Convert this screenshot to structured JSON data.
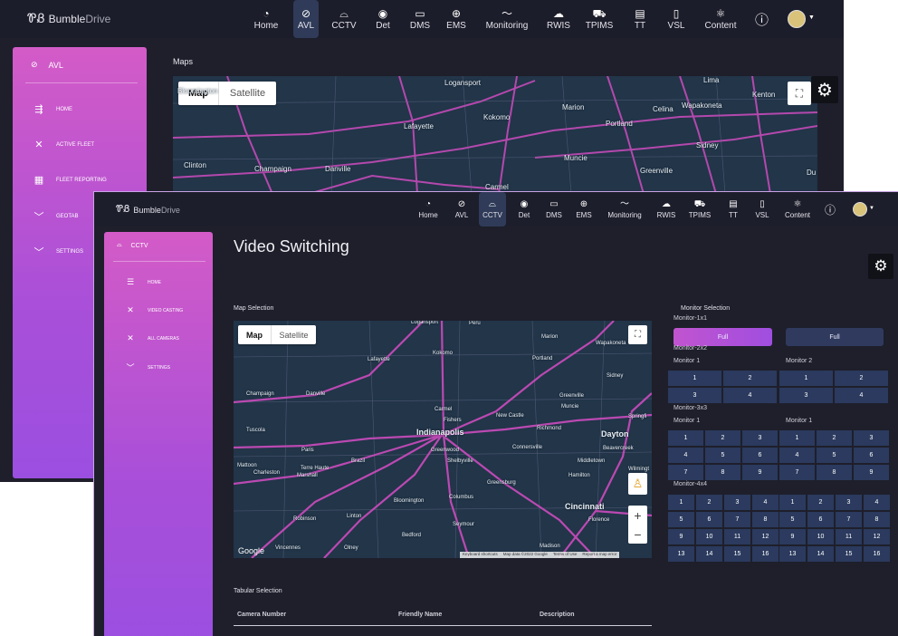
{
  "nav": {
    "items": [
      {
        "label": "Home",
        "icon": "pie-chart-icon"
      },
      {
        "label": "AVL",
        "icon": "compass-icon"
      },
      {
        "label": "CCTV",
        "icon": "camera-icon"
      },
      {
        "label": "Det",
        "icon": "radar-icon"
      },
      {
        "label": "DMS",
        "icon": "sign-icon"
      },
      {
        "label": "EMS",
        "icon": "globe-icon"
      },
      {
        "label": "Monitoring",
        "icon": "pulse-icon"
      },
      {
        "label": "RWIS",
        "icon": "cloud-icon"
      },
      {
        "label": "TPIMS",
        "icon": "truck-icon"
      },
      {
        "label": "TT",
        "icon": "board-icon"
      },
      {
        "label": "VSL",
        "icon": "phone-icon"
      },
      {
        "label": "Content",
        "icon": "atom-icon"
      }
    ],
    "info_glyph": "ⓘ"
  },
  "logo": {
    "part1": "Bumble",
    "part2": "Drive"
  },
  "back_window": {
    "active_tab": "AVL",
    "sidebar": {
      "title": "AVL",
      "items": [
        {
          "label": "HOME",
          "icon": "route-icon"
        },
        {
          "label": "ACTIVE FLEET",
          "icon": "tools-icon"
        },
        {
          "label": "FLEET REPORTING",
          "icon": "report-icon"
        },
        {
          "label": "GEOTAB",
          "icon": "chevron-down-icon"
        },
        {
          "label": "SETTINGS",
          "icon": "chevron-down-icon"
        }
      ]
    },
    "section_label": "Maps",
    "map": {
      "map_label": "Map",
      "satellite_label": "Satellite",
      "cities": [
        "Logansport",
        "Bloomington",
        "Lafayette",
        "Kokomo",
        "Marion",
        "Celina",
        "Wapakoneta",
        "Lima",
        "Kenton",
        "Portland",
        "Sidney",
        "Muncie",
        "Greenville",
        "Clinton",
        "Champaign",
        "Danville",
        "Carmel",
        "Du"
      ]
    }
  },
  "front_window": {
    "active_tab": "CCTV",
    "sidebar": {
      "title": "CCTV",
      "items": [
        {
          "label": "HOME",
          "icon": "grid-icon"
        },
        {
          "label": "VIDEO CASTING",
          "icon": "tools-icon"
        },
        {
          "label": "ALL CAMERAS",
          "icon": "tools-icon"
        },
        {
          "label": "SETTINGS",
          "icon": "chevron-down-icon"
        }
      ]
    },
    "page_title": "Video Switching",
    "map_selection_label": "Map Selection",
    "map": {
      "map_label": "Map",
      "satellite_label": "Satellite",
      "cities": [
        "Logansport",
        "Peru",
        "Marion",
        "Wapakoneta",
        "Lafayette",
        "Kokomo",
        "Portland",
        "Sidney",
        "Champaign",
        "Danville",
        "Muncie",
        "Greenville",
        "Carmel",
        "Fishers",
        "New Castle",
        "Richmond",
        "Springfi",
        "Tuscola",
        "Indianapolis",
        "Dayton",
        "Beavercreek",
        "Paris",
        "Brazil",
        "Greenwood",
        "Connersville",
        "Middletown",
        "Mattoon",
        "Charleston",
        "Terre Haute",
        "Shelbyville",
        "Marshall",
        "Hamilton",
        "Wilmingt",
        "Greensburg",
        "Bloomington",
        "Columbus",
        "Cincinnati",
        "Florence",
        "Robinson",
        "Linton",
        "Seymour",
        "Olney",
        "Vincennes",
        "Bedford",
        "Madison"
      ],
      "attribution": [
        "Keyboard shortcuts",
        "Map data ©2022 Google",
        "Terms of Use",
        "Report a map error"
      ],
      "google_label": "Google",
      "zoom_in": "+",
      "zoom_out": "−"
    },
    "tabular_label": "Tabular Selection",
    "table_headers": [
      "Camera Number",
      "Friendly Name",
      "Description"
    ],
    "monitor": {
      "title": "Monitor Selection",
      "m1x1": "Monitor-1x1",
      "full_a": "Full",
      "full_b": "Full",
      "m2x2": "Monitor-2x2",
      "m2x2_left": "Monitor 1",
      "m2x2_right": "Monitor 2",
      "m3x3": "Monitor-3x3",
      "m3x3_left": "Monitor 1",
      "m3x3_right": "Monitor 1",
      "m4x4": "Monitor-4x4",
      "grid2": [
        "1",
        "2",
        "3",
        "4"
      ],
      "grid3": [
        "1",
        "2",
        "3",
        "4",
        "5",
        "6",
        "7",
        "8",
        "9"
      ],
      "grid4": [
        "1",
        "2",
        "3",
        "4",
        "5",
        "6",
        "7",
        "8",
        "9",
        "10",
        "11",
        "12",
        "13",
        "14",
        "15",
        "16"
      ]
    }
  },
  "colors": {
    "bg": "#1e1f2b",
    "accent": "#c154cf",
    "map_water": "#223549",
    "map_roads": "#c44bb8",
    "button": "#2b3a5e"
  }
}
